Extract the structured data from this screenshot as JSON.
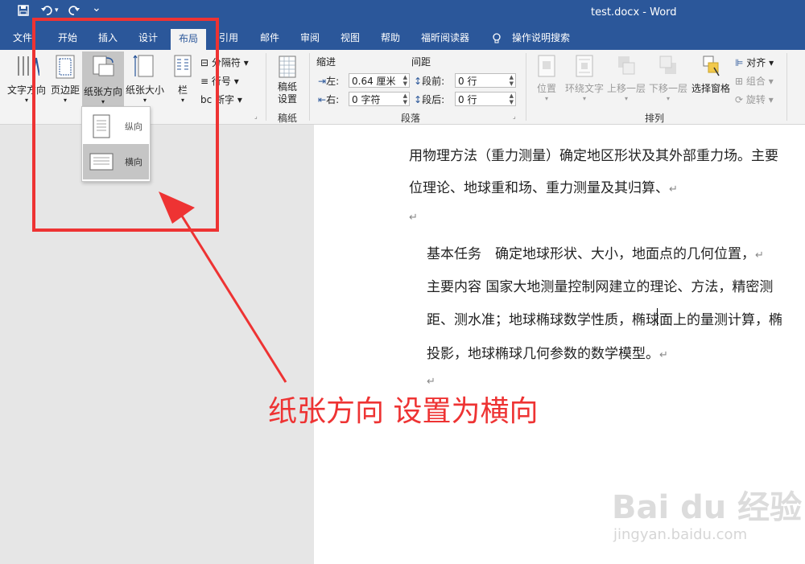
{
  "window": {
    "title": "test.docx - Word"
  },
  "quick_access": {
    "save_icon": "save-icon",
    "undo_icon": "undo-icon",
    "redo_icon": "redo-icon"
  },
  "tabs": [
    "文件",
    "开始",
    "插入",
    "设计",
    "布局",
    "引用",
    "邮件",
    "审阅",
    "视图",
    "帮助",
    "福昕阅读器",
    "操作说明搜索"
  ],
  "active_tab": "布局",
  "ribbon": {
    "page_setup": {
      "text_direction": "文字方向",
      "margins": "页边距",
      "orientation": "纸张方向",
      "size": "纸张大小",
      "columns": "栏",
      "breaks": "分隔符",
      "line_numbers": "行号",
      "hyphenation": "断字"
    },
    "draft": {
      "button": "稿纸设置",
      "group_label": "稿纸"
    },
    "paragraph": {
      "indent_title": "缩进",
      "spacing_title": "间距",
      "left_label": "左:",
      "left_value": "0.64 厘米",
      "right_label": "右:",
      "right_value": "0 字符",
      "before_label": "段前:",
      "before_value": "0 行",
      "after_label": "段后:",
      "after_value": "0 行",
      "group_label": "段落"
    },
    "arrange": {
      "position": "位置",
      "wrap_text": "环绕文字",
      "bring_forward": "上移一层",
      "send_backward": "下移一层",
      "selection_pane": "选择窗格",
      "align": "对齐",
      "group": "组合",
      "rotate": "旋转",
      "group_label": "排列"
    }
  },
  "orientation_menu": {
    "portrait": "纵向",
    "landscape": "横向"
  },
  "document": {
    "line1": "用物理方法（重力测量）确定地区形状及其外部重力场。主要",
    "line2": "位理论、地球重和场、重力测量及其归算、",
    "line3": "基本任务　确定地球形状、大小，地面点的几何位置，",
    "line4": "主要内容  国家大地测量控制网建立的理论、方法，精密测",
    "line5": "距、测水准；地球椭球数学性质，椭球面上的量测计算，椭",
    "line6": "投影，地球椭球几何参数的数学模型。"
  },
  "annotation": {
    "text": "纸张方向 设置为横向",
    "color": "#ee3333"
  },
  "watermark": {
    "brand": "Bai du 经验",
    "url": "jingyan.baidu.com"
  },
  "colors": {
    "word_blue": "#2b579a",
    "ribbon_bg": "#f3f3f3",
    "highlight": "#ee3333"
  }
}
